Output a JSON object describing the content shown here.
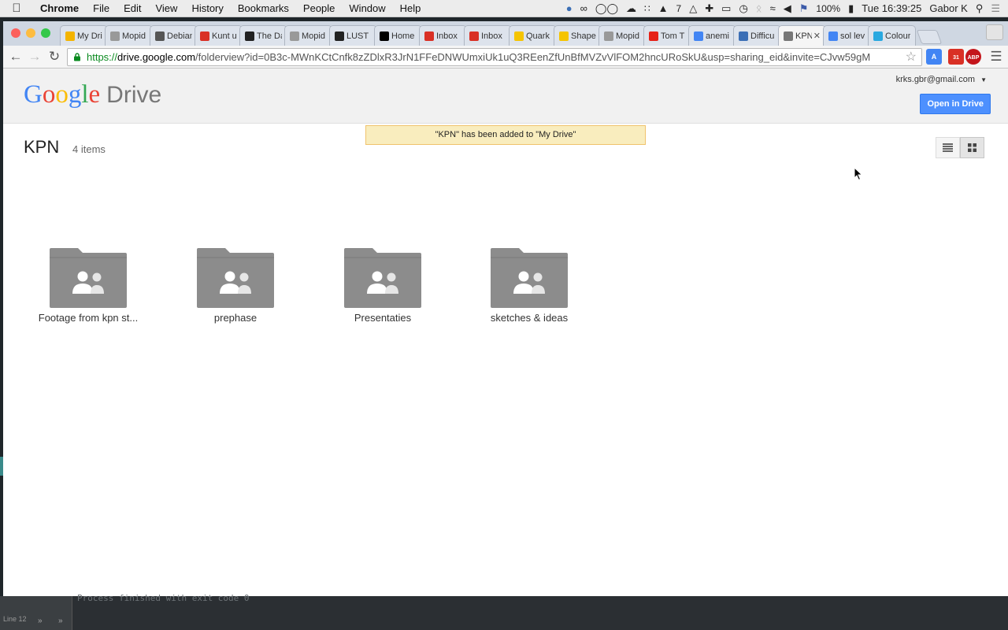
{
  "menubar": {
    "app_name": "Chrome",
    "items": [
      "File",
      "Edit",
      "View",
      "History",
      "Bookmarks",
      "People",
      "Window",
      "Help"
    ],
    "badge_count": "7",
    "battery": "100%",
    "datetime": "Tue 16:39:25",
    "user": "Gabor K"
  },
  "tabs": [
    {
      "label": "My Dri",
      "icon": "drive-icon",
      "color": "#f4b400"
    },
    {
      "label": "Mopid",
      "icon": "doc-icon",
      "color": "#999999"
    },
    {
      "label": "Debian",
      "icon": "wiki-icon",
      "color": "#555555"
    },
    {
      "label": "Kunt u",
      "icon": "gmail-icon",
      "color": "#d93025"
    },
    {
      "label": "The Da",
      "icon": "column-icon",
      "color": "#222222"
    },
    {
      "label": "Mopid",
      "icon": "doc-icon",
      "color": "#999999"
    },
    {
      "label": "LUST |",
      "icon": "lust-icon",
      "color": "#222222"
    },
    {
      "label": "Home",
      "icon": "medium-icon",
      "color": "#000000"
    },
    {
      "label": "Inbox",
      "icon": "gmail-icon",
      "color": "#d93025"
    },
    {
      "label": "Inbox",
      "icon": "gmail-icon",
      "color": "#d93025"
    },
    {
      "label": "Quark",
      "icon": "quark-icon",
      "color": "#f5c400"
    },
    {
      "label": "Shape",
      "icon": "shape-icon",
      "color": "#f5c400"
    },
    {
      "label": "Mopid",
      "icon": "doc-icon",
      "color": "#999999"
    },
    {
      "label": "Tom T",
      "icon": "youtube-icon",
      "color": "#e62117"
    },
    {
      "label": "anemi",
      "icon": "google-icon",
      "color": "#4285f4"
    },
    {
      "label": "Difficu",
      "icon": "hb-icon",
      "color": "#3b6fb6"
    },
    {
      "label": "KPN",
      "icon": "drive-folder-icon",
      "color": "#777777",
      "active": true
    },
    {
      "label": "sol lev",
      "icon": "google-icon",
      "color": "#4285f4"
    },
    {
      "label": "Colour",
      "icon": "colour-icon",
      "color": "#29a8e0"
    }
  ],
  "address": {
    "scheme": "https://",
    "host": "drive.google.com",
    "path": "/folderview?id=0B3c-MWnKCtCnfk8zZDlxR3JrN1FFeDNWUmxiUk1uQ3REenZfUnBfMVZvVlFOM2hncURoSkU&usp=sharing_eid&invite=CJvw59gM"
  },
  "extensions": {
    "calendar_badge": "31",
    "adblock_label": "ABP"
  },
  "drive": {
    "logo_google": "Google",
    "logo_product": "Drive",
    "account_email": "krks.gbr@gmail.com",
    "open_button": "Open in Drive",
    "toast": "\"KPN\" has been added to \"My Drive\"",
    "folder_name": "KPN",
    "item_count": "4 items",
    "folders": [
      {
        "name": "Footage from kpn st..."
      },
      {
        "name": "prephase"
      },
      {
        "name": "Presentaties"
      },
      {
        "name": "sketches & ideas"
      }
    ]
  },
  "ide": {
    "console_text": "Process finished with exit code 0",
    "line_label": "Line 12"
  },
  "colors": {
    "google_blue": "#4285f4",
    "google_red": "#ea4335",
    "google_yellow": "#fbbc05",
    "google_green": "#34a853",
    "folder_gray": "#8c8c8c",
    "button_blue": "#4d90fe",
    "toast_bg": "#f9edbe"
  }
}
